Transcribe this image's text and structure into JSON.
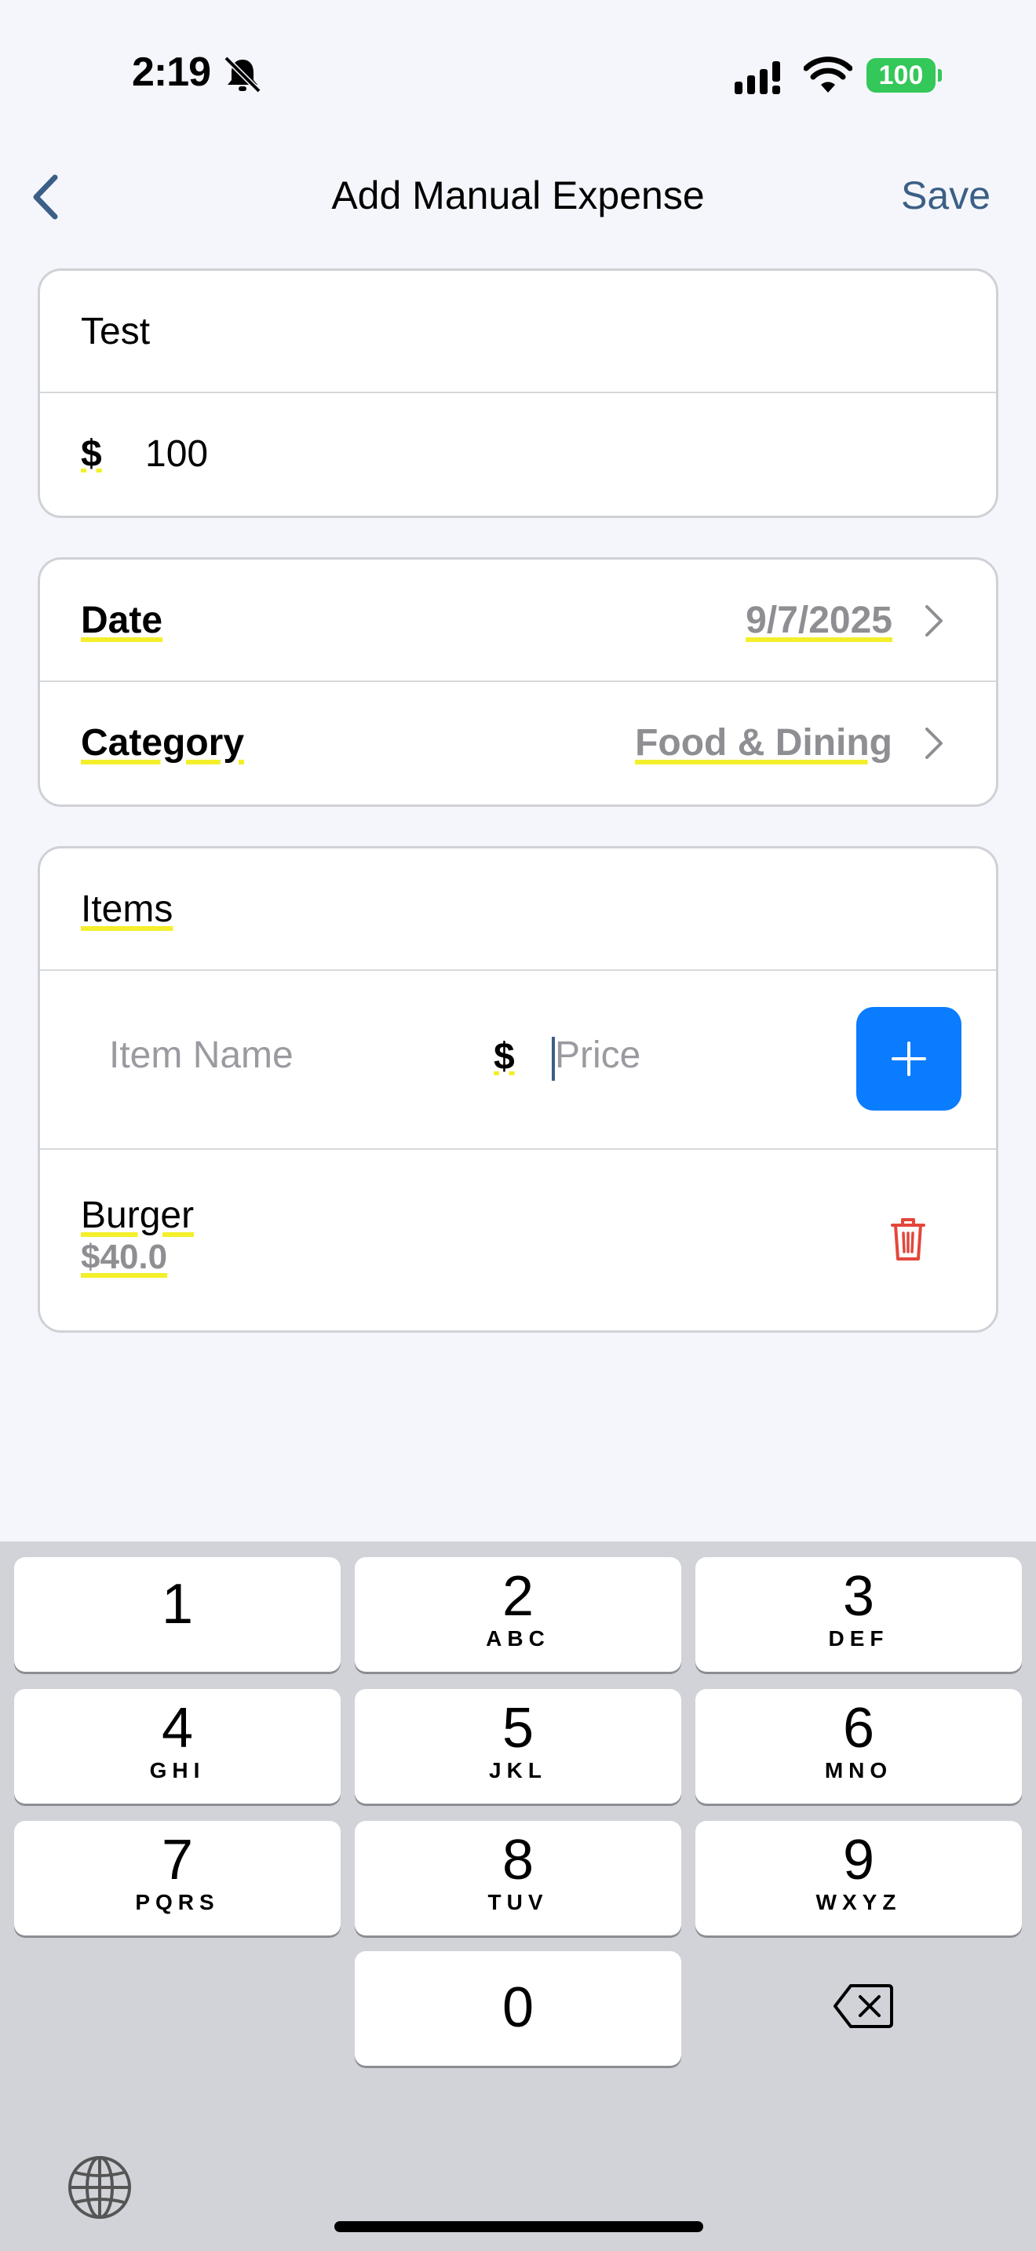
{
  "status_bar": {
    "time": "2:19",
    "battery": "100",
    "icons": [
      "bell-slash-icon",
      "cellular-signal-icon",
      "wifi-icon",
      "battery-icon"
    ]
  },
  "nav": {
    "title": "Add Manual Expense",
    "save_label": "Save",
    "back_icon": "chevron-left-icon",
    "accent_color": "#3b5f86"
  },
  "expense": {
    "name": "Test",
    "currency_symbol": "$",
    "amount": "100"
  },
  "details": {
    "date_label": "Date",
    "date_value": "9/7/2025",
    "category_label": "Category",
    "category_value": "Food & Dining"
  },
  "items_section": {
    "header": "Items",
    "item_name_placeholder": "Item Name",
    "price_currency": "$",
    "price_placeholder": "Price",
    "add_button_color": "#0a7cff",
    "items": [
      {
        "name": "Burger",
        "price": "$40.0"
      }
    ],
    "delete_color": "#e5463b"
  },
  "keyboard": {
    "keys": [
      {
        "num": "1",
        "sub": ""
      },
      {
        "num": "2",
        "sub": "ABC"
      },
      {
        "num": "3",
        "sub": "DEF"
      },
      {
        "num": "4",
        "sub": "GHI"
      },
      {
        "num": "5",
        "sub": "JKL"
      },
      {
        "num": "6",
        "sub": "MNO"
      },
      {
        "num": "7",
        "sub": "PQRS"
      },
      {
        "num": "8",
        "sub": "TUV"
      },
      {
        "num": "9",
        "sub": "WXYZ"
      },
      {
        "num": "0",
        "sub": ""
      }
    ]
  }
}
